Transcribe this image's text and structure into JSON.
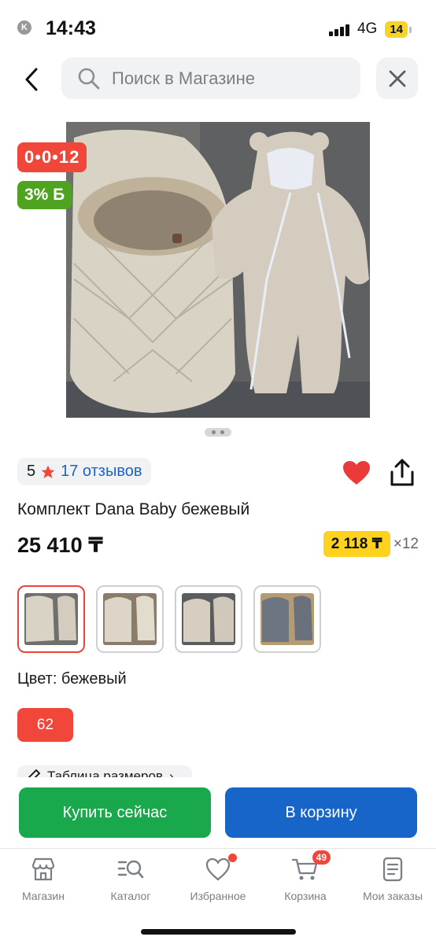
{
  "status_bar": {
    "back_app": "Kaspi.kz",
    "time": "14:43",
    "network": "4G",
    "battery": "14"
  },
  "header": {
    "search_placeholder": "Поиск в Магазине"
  },
  "product": {
    "badge_installment": "0•0•12",
    "badge_bonus": "3% Б",
    "rating": "5",
    "reviews": "17 отзывов",
    "title": "Комплект Dana Baby бежевый",
    "price": "25 410 ₸",
    "installment_price": "2 118 ₸",
    "installment_months": "×12",
    "color_label": "Цвет: бежевый",
    "size": "62",
    "size_table": "Таблица размеров",
    "favorite": true,
    "thumbnails_count": 4,
    "selected_thumbnail": 1
  },
  "actions": {
    "buy_now": "Купить сейчас",
    "add_to_cart": "В корзину"
  },
  "nav": {
    "items": [
      {
        "label": "Магазин",
        "icon": "store-icon"
      },
      {
        "label": "Каталог",
        "icon": "catalog-search-icon"
      },
      {
        "label": "Избранное",
        "icon": "heart-icon"
      },
      {
        "label": "Корзина",
        "icon": "cart-icon",
        "badge": "49"
      },
      {
        "label": "Мои заказы",
        "icon": "orders-icon"
      }
    ]
  },
  "colors": {
    "accent_red": "#f1463a",
    "bonus_green": "#4fa321",
    "buy_green": "#19a94c",
    "cart_blue": "#1765c9",
    "installment_yellow": "#ffd21f",
    "link_blue": "#1f64c3"
  }
}
